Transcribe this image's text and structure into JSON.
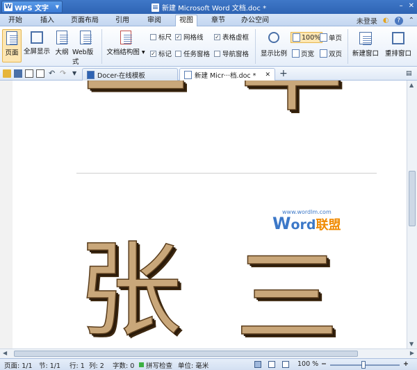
{
  "app": {
    "name": "WPS 文字",
    "logo": "W",
    "title": "新建 Microsoft Word 文档.doc *"
  },
  "titlebar": {
    "login": "未登录",
    "min": "–",
    "close": "✕"
  },
  "tabs": [
    "开始",
    "插入",
    "页面布局",
    "引用",
    "审阅",
    "视图",
    "章节",
    "办公空间"
  ],
  "active_tab": "视图",
  "ribbon": {
    "page": "页面",
    "fullscreen": "全屏显示",
    "outline": "大纲",
    "web": "Web版式",
    "structure": "文档结构图",
    "ruler": "标尺",
    "gridlines": "网格线",
    "table_grid": "表格虚框",
    "marks": "标记",
    "task_pane": "任务窗格",
    "nav_pane": "导航窗格",
    "zoom": "显示比例",
    "zoom100": "100%",
    "single": "单页",
    "page_width": "页宽",
    "double": "双页",
    "new_window": "新建窗口",
    "rearrange": "重排窗口"
  },
  "doc_tabs": [
    {
      "label": "Docer-在线模板"
    },
    {
      "label": "新建 Micr···档.doc *"
    }
  ],
  "doc_content": {
    "char_top_left": "一",
    "char_top_right": "华",
    "char_left": "张",
    "char_right": "三"
  },
  "watermark": {
    "url": "www.wordlm.com",
    "w": "W",
    "ord": "ord",
    "cn": "联盟"
  },
  "status": {
    "page": "页面: 1/1",
    "section": "节: 1/1",
    "line": "行: 1",
    "col": "列: 2",
    "words": "字数: 0",
    "spell": "拼写检查",
    "unit": "单位: 毫米",
    "zoom": "100 %"
  },
  "zoom_level": 1.0,
  "colors": {
    "titlebar": "#2e63b3",
    "glyph": "#c9a77a",
    "watermark_blue": "#3c78c8",
    "watermark_orange": "#f08a00"
  }
}
